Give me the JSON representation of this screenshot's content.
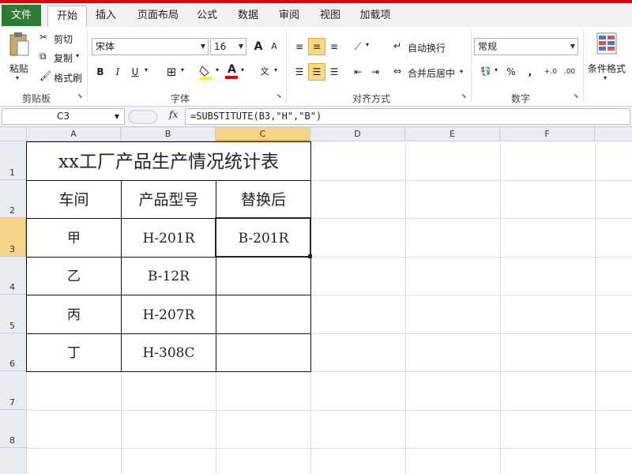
{
  "ribbon_tabs": {
    "file": "文件",
    "home": "开始",
    "insert": "插入",
    "page_layout": "页面布局",
    "formulas": "公式",
    "data": "数据",
    "review": "审阅",
    "view": "视图",
    "addins": "加载项"
  },
  "clipboard": {
    "paste": "粘贴",
    "cut": "剪切",
    "copy": "复制",
    "format_painter": "格式刷",
    "label": "剪贴板"
  },
  "font": {
    "font_name": "宋体",
    "font_size": "16",
    "grow": "A",
    "shrink": "A",
    "bold": "B",
    "italic": "I",
    "underline": "U",
    "label": "字体"
  },
  "alignment": {
    "wrap_text": "自动换行",
    "merge_center": "合并后居中",
    "label": "对齐方式"
  },
  "number": {
    "format": "常规",
    "percent": "%",
    "comma": ",",
    "label": "数字"
  },
  "styles": {
    "conditional_format": "条件格式"
  },
  "formula_bar": {
    "name_box": "C3",
    "fx": "fx",
    "formula": "=SUBSTITUTE(B3,\"H\",\"B\")"
  },
  "grid": {
    "columns": [
      "A",
      "B",
      "C",
      "D",
      "E",
      "F"
    ],
    "rows": [
      "1",
      "2",
      "3",
      "4",
      "5",
      "6",
      "7",
      "8"
    ]
  },
  "table": {
    "title": "xx工厂产品生产情况统计表",
    "headers": [
      "车间",
      "产品型号",
      "替换后"
    ],
    "rows": [
      [
        "甲",
        "H-201R",
        "B-201R"
      ],
      [
        "乙",
        "B-12R",
        ""
      ],
      [
        "丙",
        "H-207R",
        ""
      ],
      [
        "丁",
        "H-308C",
        ""
      ]
    ]
  },
  "colors": {
    "file_tab": "#2f7a34",
    "selection_header": "#f8d48b",
    "accent_red": "#e00000"
  }
}
